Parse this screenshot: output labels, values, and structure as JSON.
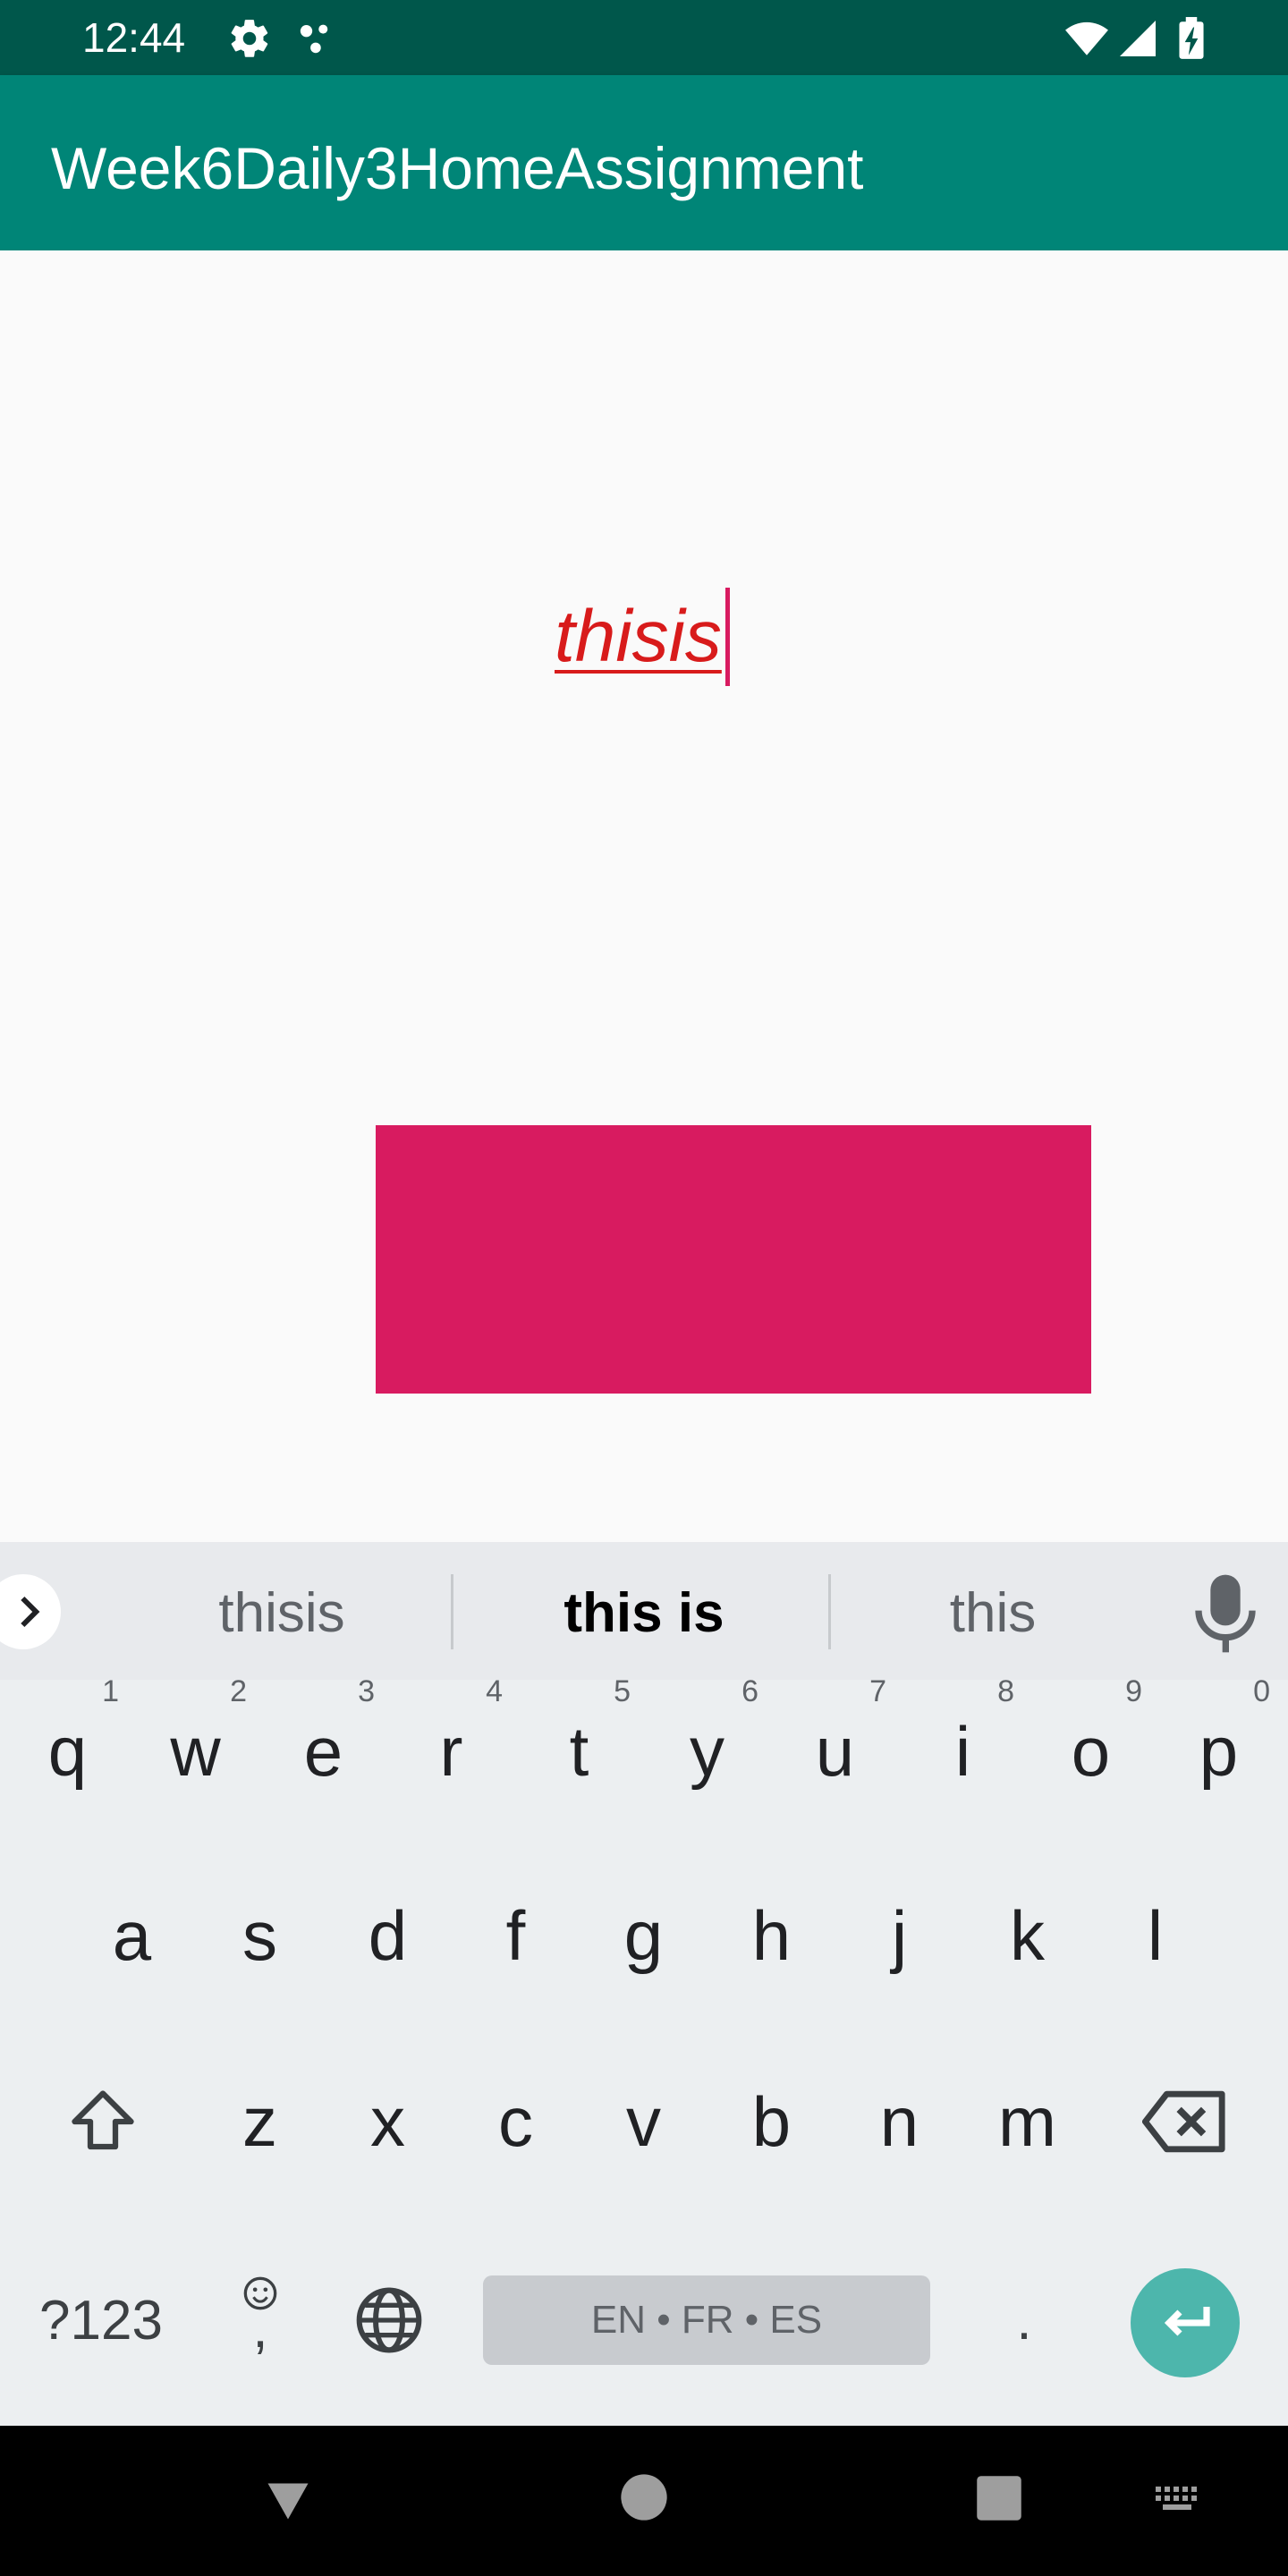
{
  "status_bar": {
    "time": "12:44",
    "icons": [
      "gear-icon",
      "dots-icon",
      "wifi-icon",
      "signal-icon",
      "battery-charging-icon"
    ]
  },
  "app_bar": {
    "title": "Week6Daily3HomeAssignment"
  },
  "content": {
    "edit_text_value": "thisis"
  },
  "keyboard": {
    "suggestions": [
      "thisis",
      "this is",
      "this"
    ],
    "row1": [
      {
        "key": "q",
        "hint": "1"
      },
      {
        "key": "w",
        "hint": "2"
      },
      {
        "key": "e",
        "hint": "3"
      },
      {
        "key": "r",
        "hint": "4"
      },
      {
        "key": "t",
        "hint": "5"
      },
      {
        "key": "y",
        "hint": "6"
      },
      {
        "key": "u",
        "hint": "7"
      },
      {
        "key": "i",
        "hint": "8"
      },
      {
        "key": "o",
        "hint": "9"
      },
      {
        "key": "p",
        "hint": "0"
      }
    ],
    "row2": [
      "a",
      "s",
      "d",
      "f",
      "g",
      "h",
      "j",
      "k",
      "l"
    ],
    "row3": [
      "z",
      "x",
      "c",
      "v",
      "b",
      "n",
      "m"
    ],
    "symbols_label": "?123",
    "comma_label": ",",
    "period_label": ".",
    "space_label": "EN • FR • ES"
  },
  "colors": {
    "status_bar": "#00574b",
    "app_bar": "#008577",
    "accent": "#d81b60",
    "enter_key": "#4db6ac"
  }
}
